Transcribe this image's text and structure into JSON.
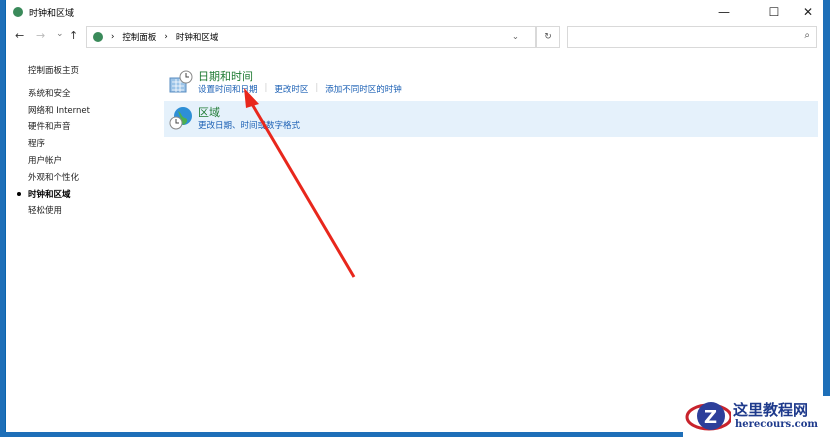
{
  "window": {
    "title": "时钟和区域",
    "minimize": "—",
    "maximize": "☐",
    "close": "✕"
  },
  "nav": {
    "back": "←",
    "forward": "→",
    "recent": "⌄",
    "up": "↑",
    "breadcrumb": [
      "控制面板",
      "时钟和区域"
    ],
    "separator": "›",
    "dropdown": "⌄",
    "refresh": "↻",
    "search_placeholder": "",
    "search_icon": "⌕"
  },
  "sidebar": {
    "home": "控制面板主页",
    "items": [
      "系统和安全",
      "网络和 Internet",
      "硬件和声音",
      "程序",
      "用户帐户",
      "外观和个性化",
      "时钟和区域",
      "轻松使用"
    ],
    "current": "时钟和区域"
  },
  "categories": [
    {
      "title": "日期和时间",
      "links": [
        "设置时间和日期",
        "更改时区",
        "添加不同时区的时钟"
      ]
    },
    {
      "title": "区域",
      "links": [
        "更改日期、时间或数字格式"
      ]
    }
  ],
  "watermark": {
    "title": "这里教程网",
    "url": "herecours.com"
  },
  "colors": {
    "accent": "#1a5fb4",
    "category_title": "#1e7a32",
    "selected_bg": "#e5f1fb",
    "arrow": "#e8271c"
  }
}
